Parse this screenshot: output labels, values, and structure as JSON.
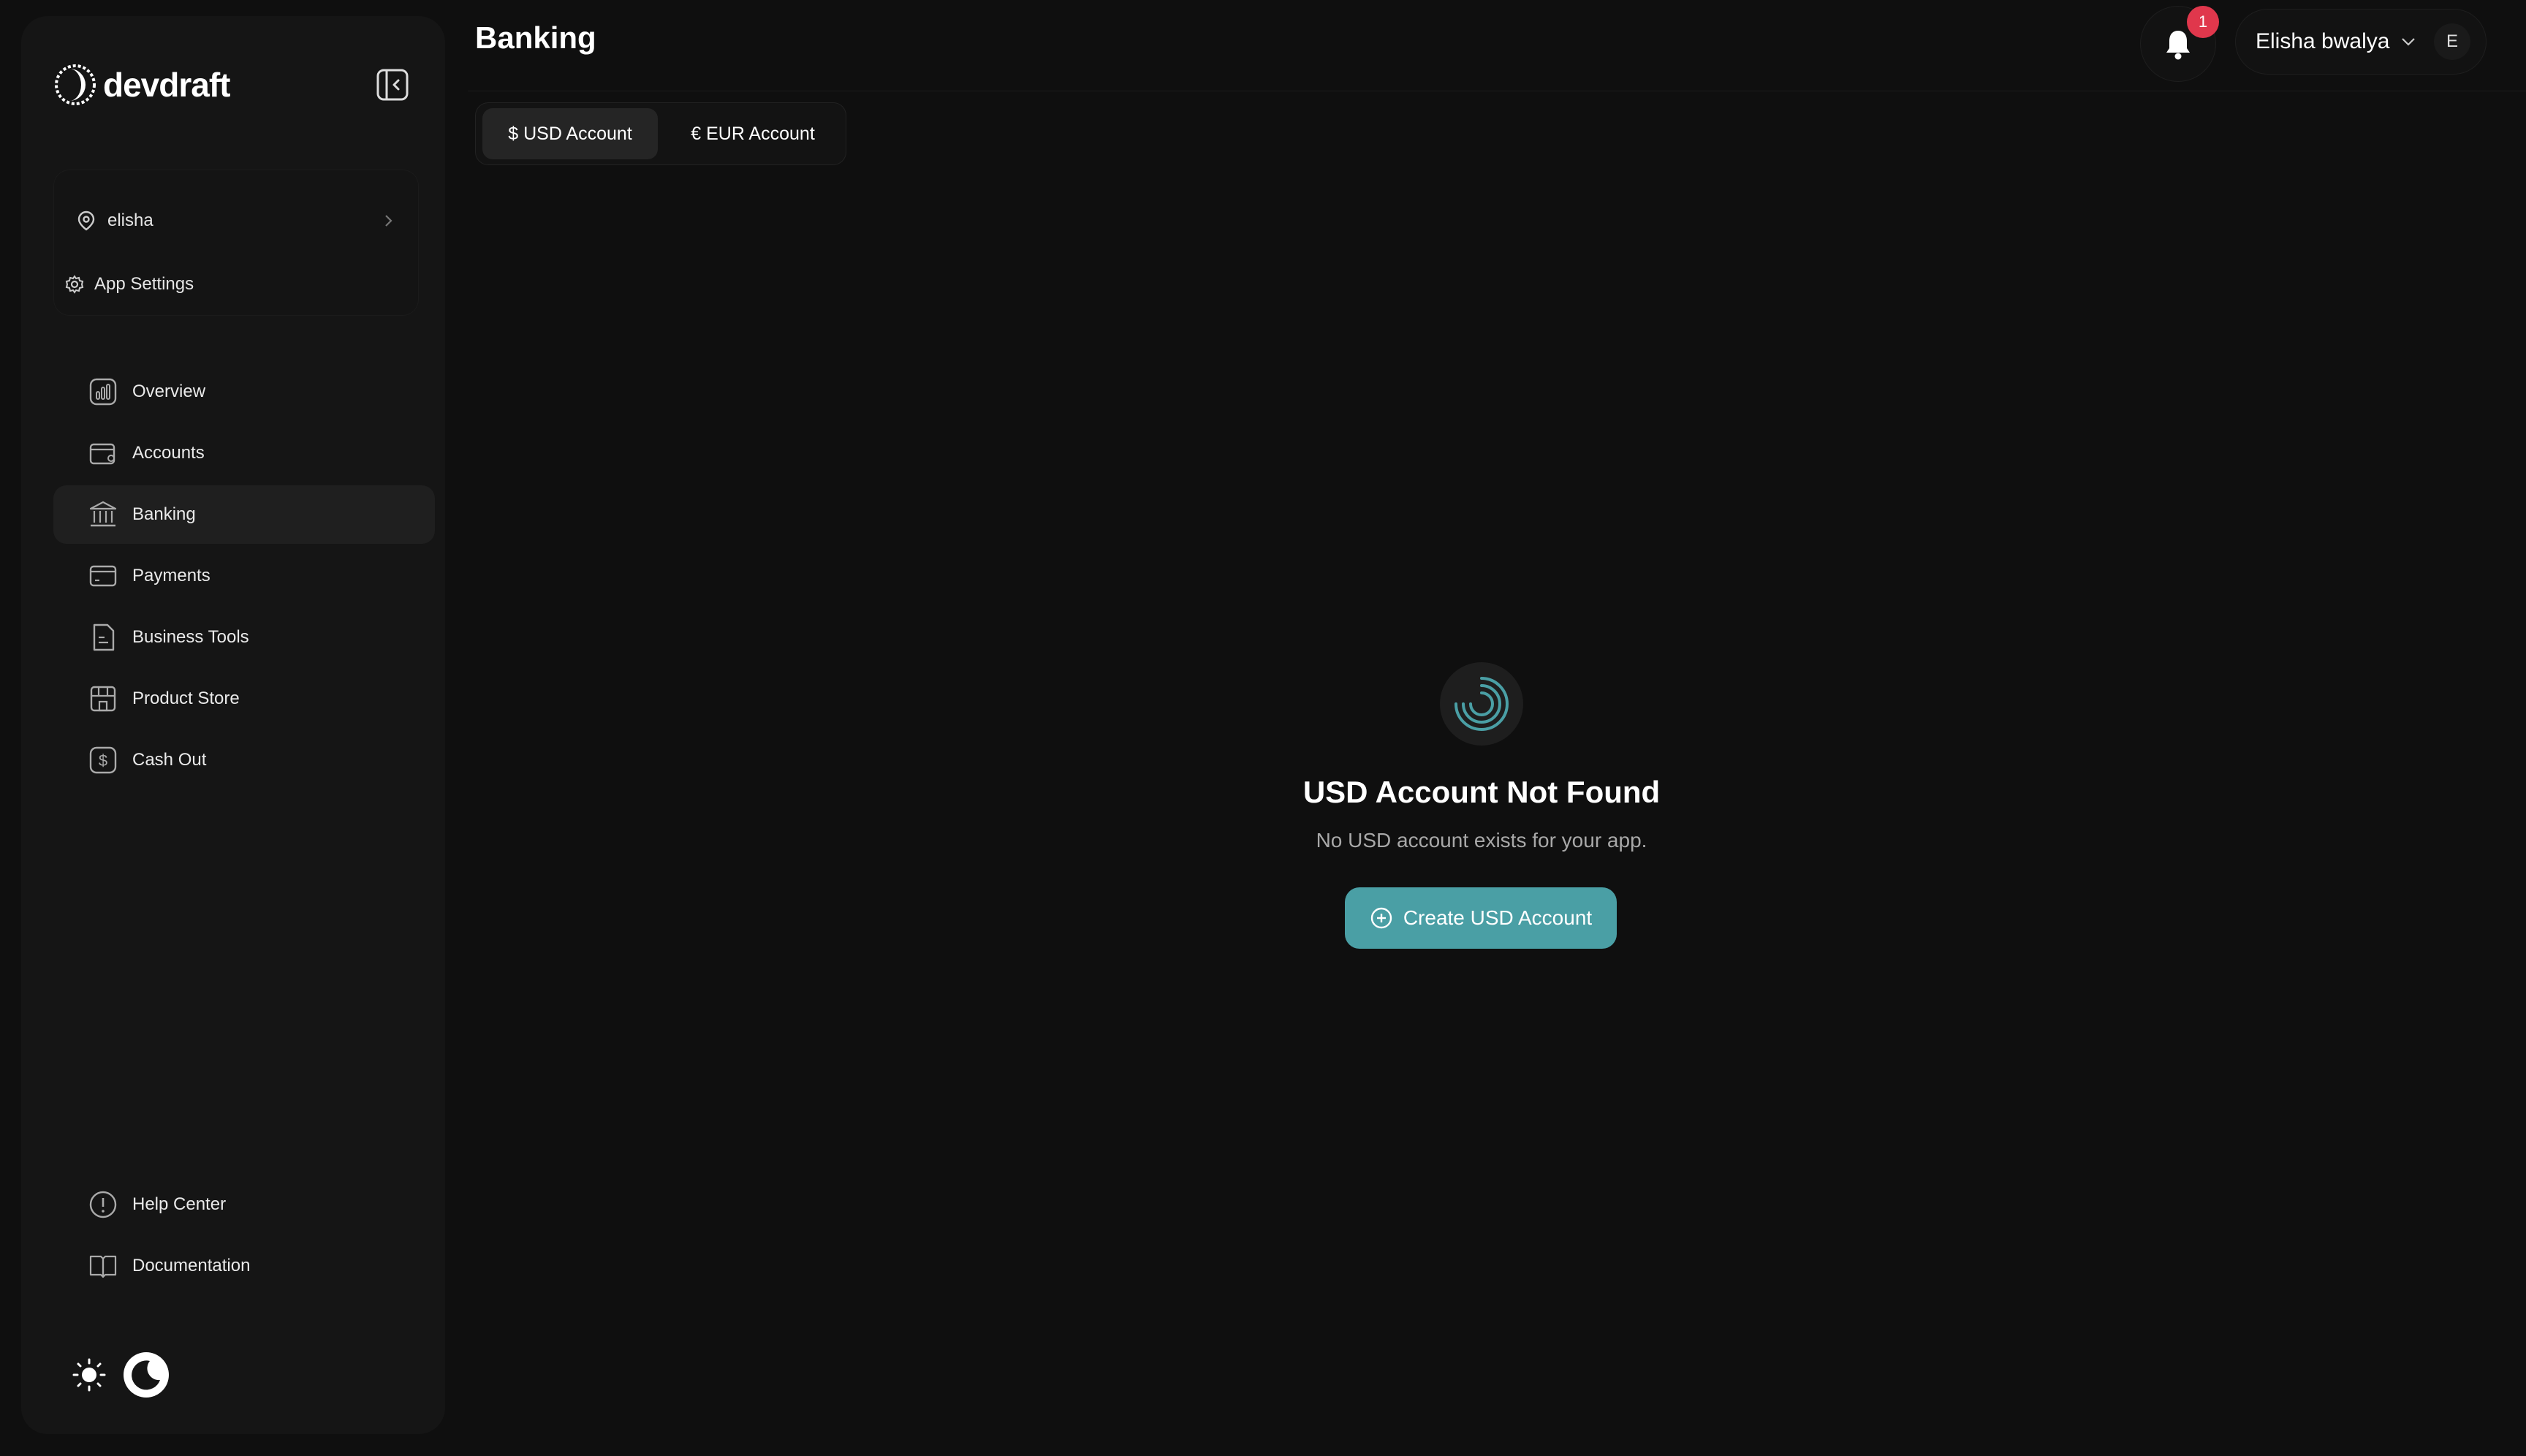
{
  "brand": {
    "name": "devdraft"
  },
  "sidebar": {
    "org_label": "elisha",
    "settings_label": "App Settings",
    "nav": [
      {
        "label": "Overview",
        "icon": "chart-icon"
      },
      {
        "label": "Accounts",
        "icon": "wallet-icon"
      },
      {
        "label": "Banking",
        "icon": "bank-icon",
        "active": true
      },
      {
        "label": "Payments",
        "icon": "card-icon"
      },
      {
        "label": "Business Tools",
        "icon": "document-icon"
      },
      {
        "label": "Product Store",
        "icon": "store-icon"
      },
      {
        "label": "Cash Out",
        "icon": "dollar-icon"
      }
    ],
    "bottom": [
      {
        "label": "Help Center",
        "icon": "alert-circle-icon"
      },
      {
        "label": "Documentation",
        "icon": "book-icon"
      }
    ]
  },
  "header": {
    "title": "Banking",
    "notifications_count": "1",
    "user_name": "Elisha bwalya",
    "user_initial": "E"
  },
  "tabs": [
    {
      "label": "$ USD Account",
      "active": true
    },
    {
      "label": "€ EUR Account",
      "active": false
    }
  ],
  "empty_state": {
    "title": "USD Account Not Found",
    "subtitle": "No USD account exists for your app.",
    "button_label": "Create USD Account"
  },
  "colors": {
    "background": "#0f0f0f",
    "sidebar": "#151515",
    "accent": "#4a9fa5",
    "badge": "#e0374c"
  }
}
